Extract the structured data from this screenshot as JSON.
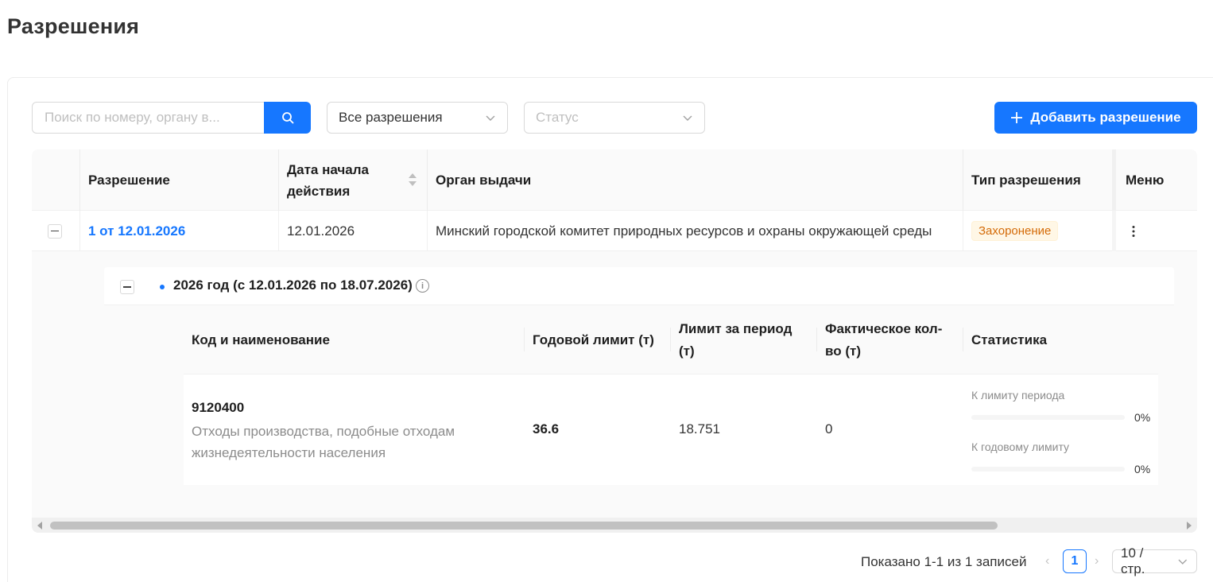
{
  "page": {
    "title": "Разрешения"
  },
  "toolbar": {
    "search_placeholder": "Поиск по номеру, органу в...",
    "type_filter": "Все разрешения",
    "status_placeholder": "Статус",
    "add_button": "Добавить разрешение",
    "icons": {
      "search": "search-icon",
      "add": "plus-icon",
      "chevron": "chevron-down-icon"
    },
    "accent_color": "#1677ff"
  },
  "table": {
    "columns": {
      "permit": "Разрешение",
      "start_date": "Дата начала действия",
      "authority": "Орган выдачи",
      "type": "Тип разрешения",
      "menu": "Меню"
    },
    "rows": [
      {
        "permit": "1 от 12.01.2026",
        "start_date": "12.01.2026",
        "authority": "Минский городской комитет природных ресурсов и охраны окружающей среды",
        "type": "Захоронение",
        "menu_icon": "more-vertical-icon",
        "expanded": true,
        "period": {
          "title": "2026 год (с 12.01.2026 по 18.07.2026)",
          "columns": {
            "code": "Код и наименование",
            "annual_limit": "Годовой лимит (т)",
            "period_limit": "Лимит за период (т)",
            "actual": "Фактическое кол-во (т)",
            "stats": "Статистика"
          },
          "items": [
            {
              "code": "9120400",
              "name": "Отходы производства, подобные отходам жизнедеятельности населения",
              "annual_limit": "36.6",
              "period_limit": "18.751",
              "actual": "0",
              "stats": {
                "period_label": "К лимиту периода",
                "period_pct": "0%",
                "period_fraction": 0,
                "annual_label": "К годовому лимиту",
                "annual_pct": "0%",
                "annual_fraction": 0
              }
            }
          ]
        }
      }
    ]
  },
  "pagination": {
    "total_text": "Показано 1-1 из 1 записей",
    "current_page": "1",
    "page_size": "10 / стр.",
    "prev": "‹",
    "next": "›"
  }
}
